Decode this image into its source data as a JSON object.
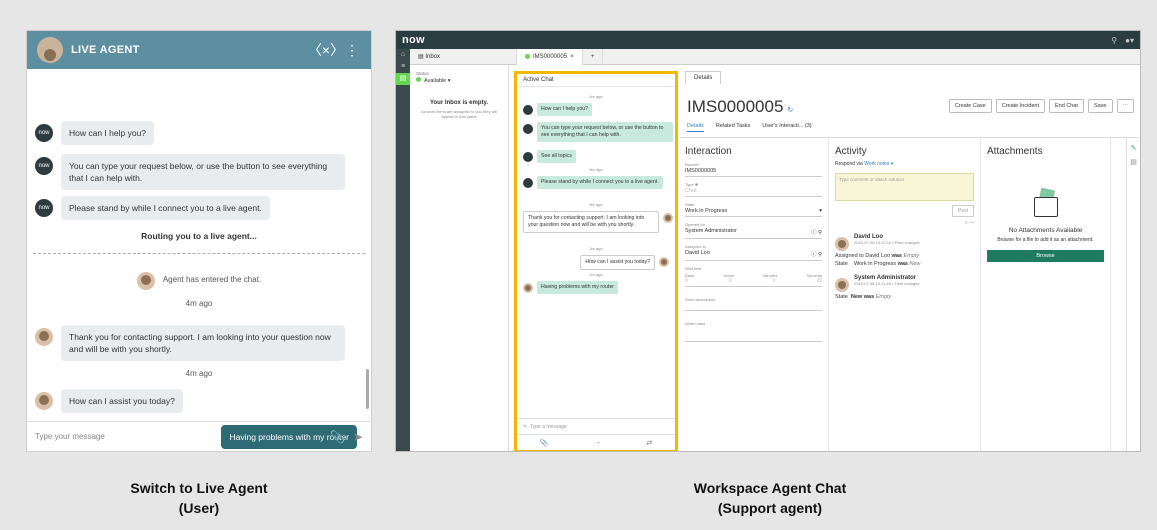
{
  "live_agent": {
    "title": "LIVE AGENT",
    "chat_icon": "chat-close-icon",
    "menu_icon": "more-vertical-icon",
    "bot_label": "now",
    "messages": [
      "How can I help you?",
      "You can type your request below, or use the button to see everything that I can help with.",
      "Please stand by while I connect you to a live agent."
    ],
    "routing": "Routing you to a live agent...",
    "agent_entered": "Agent has entered the chat.",
    "time1": "4m ago",
    "agent_msg1": "Thank you for contacting support. I am looking into your question now and will be with you shortly.",
    "time2": "4m ago",
    "agent_msg2": "How can I assist you today?",
    "user_msg": "Having problems with my router",
    "input_placeholder": "Type your message"
  },
  "captions": {
    "left_line1": "Switch to Live Agent",
    "left_line2": "(User)",
    "right_line1": "Workspace Agent Chat",
    "right_line2": "(Support agent)"
  },
  "workspace": {
    "logo": "now",
    "tabs": {
      "inbox": "Inbox",
      "record": "IMS0000005",
      "add": "+"
    },
    "inbox": {
      "status_label": "Status",
      "status_value": "Available ▾",
      "empty_title": "Your Inbox is empty.",
      "empty_sub": "As work items are assigned to you they will appear in this panel"
    },
    "chat": {
      "header": "Active Chat",
      "t1": "4m ago",
      "m1": "How can I help you?",
      "m2": "You can type your request below, or use the button to see everything that I can help with.",
      "m3": "See all topics",
      "t2": "5m ago",
      "m4": "Please stand by while I connect you to a live agent.",
      "t3": "5m ago",
      "m5": "Thank you for contacting support. I am looking into your question now and will be with you shortly.",
      "t4": "2m ago",
      "m6": "How can I assist you today?",
      "t5": "2m ago",
      "m7": "Having problems with my router",
      "input_placeholder": "Type a message"
    },
    "details": {
      "tab": "Details",
      "record": "IMS0000005",
      "buttons": [
        "Create Case",
        "Create Incident",
        "End Chat",
        "Save",
        "⋯"
      ],
      "subtabs": [
        "Details",
        "Related Tasks",
        "User's Interacti...  (3)"
      ],
      "interaction": {
        "heading": "Interaction",
        "number_label": "Number",
        "number": "IMS0000005",
        "type_label": "Type ✱",
        "type": "Chat",
        "state_label": "State",
        "state": "Work in Progress",
        "opened_for_label": "Opened for",
        "opened_for": "System Administrator",
        "assigned_to_label": "Assigned to",
        "assigned_to": "David Loo",
        "wait_time_label": "Wait time",
        "dur_labels": [
          "Days",
          "Hours",
          "Minutes",
          "Seconds"
        ],
        "dur_values": [
          "0",
          "0",
          "0",
          "29"
        ],
        "short_desc_label": "Short description",
        "work_notes_label": "Work notes"
      },
      "activity": {
        "heading": "Activity",
        "respond_via": "Respond via",
        "respond_link": "Work notes ▾",
        "compose_placeholder": "Type comment or attach solution",
        "post": "Post",
        "e1_name": "David Loo",
        "e1_meta": "2019-07-08 13:12:14 • Field changes",
        "e1_c1a": "Assigned to",
        "e1_c1b": "David Loo",
        "e1_c1c": "was",
        "e1_c1d": "Empty",
        "e1_c2a": "State",
        "e1_c2b": "Work in Progress",
        "e1_c2c": "was",
        "e1_c2d": "New",
        "e2_name": "System Administrator",
        "e2_meta": "2019-07-08 13:11:48 • Field changes",
        "e2_c1a": "State",
        "e2_c1b": "New",
        "e2_c1c": "was",
        "e2_c1d": "Empty"
      },
      "attachments": {
        "heading": "Attachments",
        "none": "No Attachments Available",
        "sub": "Browse for a file to add it as an attachment.",
        "browse": "Browse"
      }
    }
  }
}
